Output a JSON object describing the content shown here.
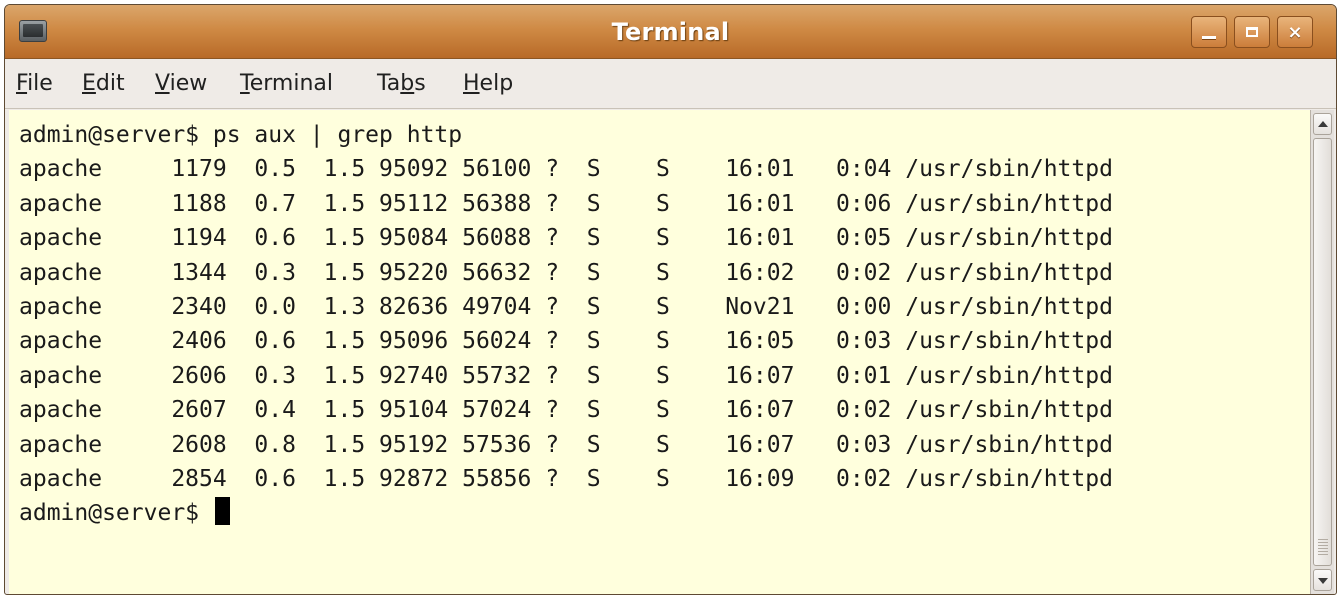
{
  "window": {
    "title": "Terminal"
  },
  "window_controls": {
    "minimize": "_",
    "maximize": "□",
    "close": "×"
  },
  "menubar": {
    "items": [
      {
        "label": "File",
        "mnemonic_index": 0
      },
      {
        "label": "Edit",
        "mnemonic_index": 0
      },
      {
        "label": "View",
        "mnemonic_index": 0
      },
      {
        "label": "Terminal",
        "mnemonic_index": 0
      },
      {
        "label": "Tabs",
        "mnemonic_index": 2
      },
      {
        "label": "Help",
        "mnemonic_index": 0
      }
    ]
  },
  "terminal": {
    "command_line": "admin@server$ ps aux | grep http",
    "rows": [
      "apache     1179  0.5  1.5 95092 56100 ?  S    S    16:01   0:04 /usr/sbin/httpd",
      "apache     1188  0.7  1.5 95112 56388 ?  S    S    16:01   0:06 /usr/sbin/httpd",
      "apache     1194  0.6  1.5 95084 56088 ?  S    S    16:01   0:05 /usr/sbin/httpd",
      "apache     1344  0.3  1.5 95220 56632 ?  S    S    16:02   0:02 /usr/sbin/httpd",
      "apache     2340  0.0  1.3 82636 49704 ?  S    S    Nov21   0:00 /usr/sbin/httpd",
      "apache     2406  0.6  1.5 95096 56024 ?  S    S    16:05   0:03 /usr/sbin/httpd",
      "apache     2606  0.3  1.5 92740 55732 ?  S    S    16:07   0:01 /usr/sbin/httpd",
      "apache     2607  0.4  1.5 95104 57024 ?  S    S    16:07   0:02 /usr/sbin/httpd",
      "apache     2608  0.8  1.5 95192 57536 ?  S    S    16:07   0:03 /usr/sbin/httpd",
      "apache     2854  0.6  1.5 92872 55856 ?  S    S    16:09   0:02 /usr/sbin/httpd"
    ],
    "prompt": "admin@server$ "
  },
  "colors": {
    "terminal_background": "#ffffdd",
    "titlebar_accent": "#cf8a45",
    "text": "#1a1a1a"
  }
}
